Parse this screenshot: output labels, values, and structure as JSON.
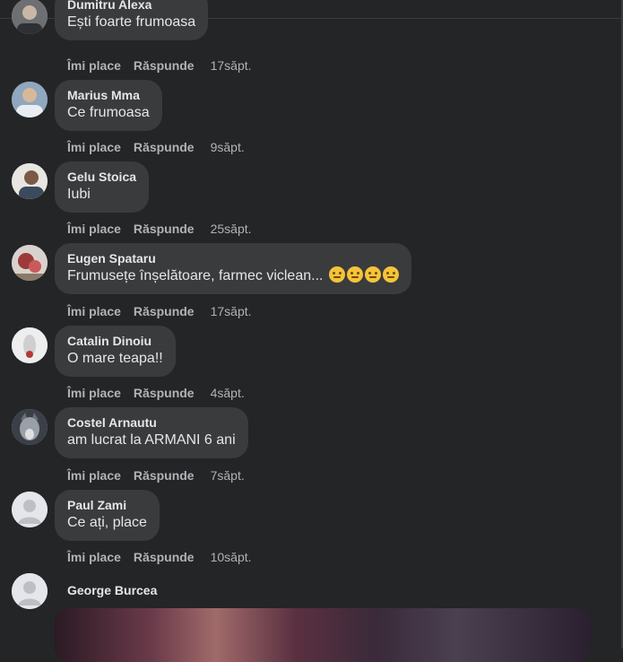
{
  "actions": {
    "like": "Îmi place",
    "reply": "Răspunde"
  },
  "colors": {
    "background": "#242526",
    "bubble": "#3a3b3c",
    "text": "#e4e6eb",
    "secondary": "#b0b3b8"
  },
  "comments": [
    {
      "name": "Dumitru Alexa",
      "text": "Ești foarte frumoasa",
      "time": "17săpt."
    },
    {
      "name": "Marius Mma",
      "text": "Ce frumoasa",
      "time": "9săpt."
    },
    {
      "name": "Gelu Stoica",
      "text": "Iubi",
      "time": "25săpt."
    },
    {
      "name": "Eugen Spataru",
      "text": "Frumusețe înșelătoare, farmec viclean...",
      "time": "17săpt.",
      "emojis": [
        "thinking-face-emoji",
        "tired-face-emoji",
        "sleepy-face-emoji",
        "worried-face-emoji"
      ]
    },
    {
      "name": "Catalin Dinoiu",
      "text": "O mare teapa!!",
      "time": "4săpt."
    },
    {
      "name": "Costel Arnautu",
      "text": "am lucrat la ARMANI 6 ani",
      "time": "7săpt."
    },
    {
      "name": "Paul Zami",
      "text": "Ce ați, place",
      "time": "10săpt."
    },
    {
      "name": "George Burcea"
    }
  ]
}
